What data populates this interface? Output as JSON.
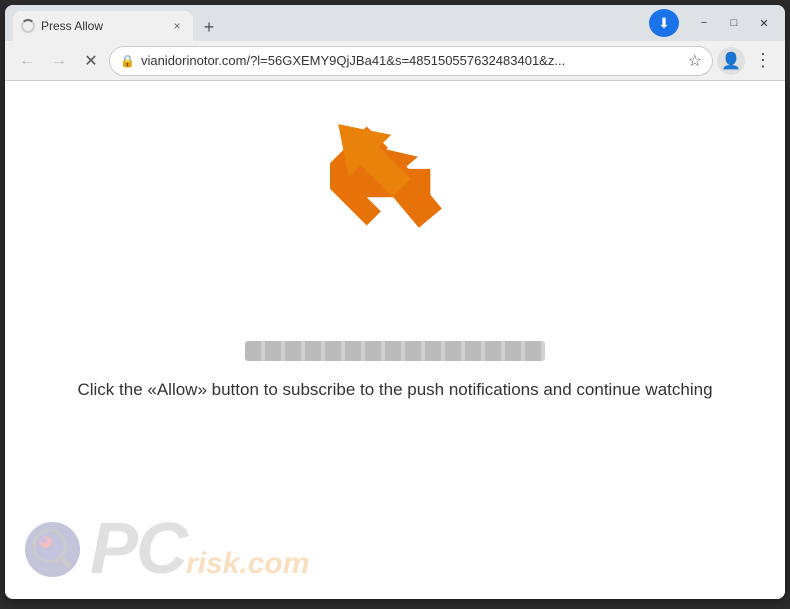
{
  "browser": {
    "title": "Press Allow",
    "tab": {
      "title": "Press Allow",
      "close_label": "×"
    },
    "new_tab_label": "+",
    "window_controls": {
      "minimize": "−",
      "maximize": "□",
      "close": "✕"
    },
    "toolbar": {
      "back_label": "←",
      "forward_label": "→",
      "stop_label": "✕",
      "address": "vianidorinotor.com/?l=56GXEMY9QjJBa41&s=485150557632483401&z...",
      "lock_icon": "🔒"
    }
  },
  "page": {
    "instruction": "Click the «Allow» button to subscribe to the push notifications and continue watching"
  },
  "watermark": {
    "pc_text": "PC",
    "risk_text": "risk.com"
  }
}
